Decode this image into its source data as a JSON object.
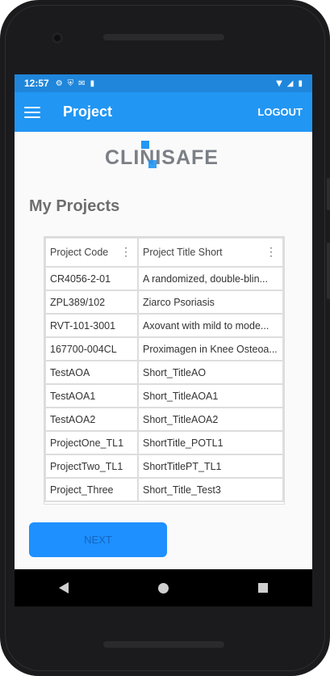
{
  "statusbar": {
    "time": "12:57",
    "left_icons": [
      "settings-icon",
      "shield-icon",
      "mail-icon",
      "sd-card-icon"
    ],
    "right_icons": [
      "wifi-icon",
      "signal-icon",
      "battery-icon"
    ]
  },
  "appbar": {
    "title": "Project",
    "logout_label": "LOGOUT"
  },
  "logo": {
    "text": "CLINISAFE"
  },
  "page_title": "My Projects",
  "table": {
    "headers": [
      "Project Code",
      "Project Title Short"
    ],
    "rows": [
      [
        "CR4056-2-01",
        "A randomized, double-blin..."
      ],
      [
        "ZPL389/102",
        "Ziarco Psoriasis"
      ],
      [
        "RVT-101-3001",
        "Axovant with mild to mode..."
      ],
      [
        "167700-004CL",
        "Proximagen in Knee Osteoa..."
      ],
      [
        "TestAOA",
        "Short_TitleAO"
      ],
      [
        "TestAOA1",
        "Short_TitleAOA1"
      ],
      [
        "TestAOA2",
        "Short_TitleAOA2"
      ],
      [
        "ProjectOne_TL1",
        "ShortTitle_POTL1"
      ],
      [
        "ProjectTwo_TL1",
        "ShortTitlePT_TL1"
      ],
      [
        "Project_Three",
        "Short_Title_Test3"
      ]
    ]
  },
  "next_label": "NEXT",
  "colors": {
    "appbar": "#2196f3",
    "statusbar": "#1f86db",
    "button": "#1e90ff"
  }
}
